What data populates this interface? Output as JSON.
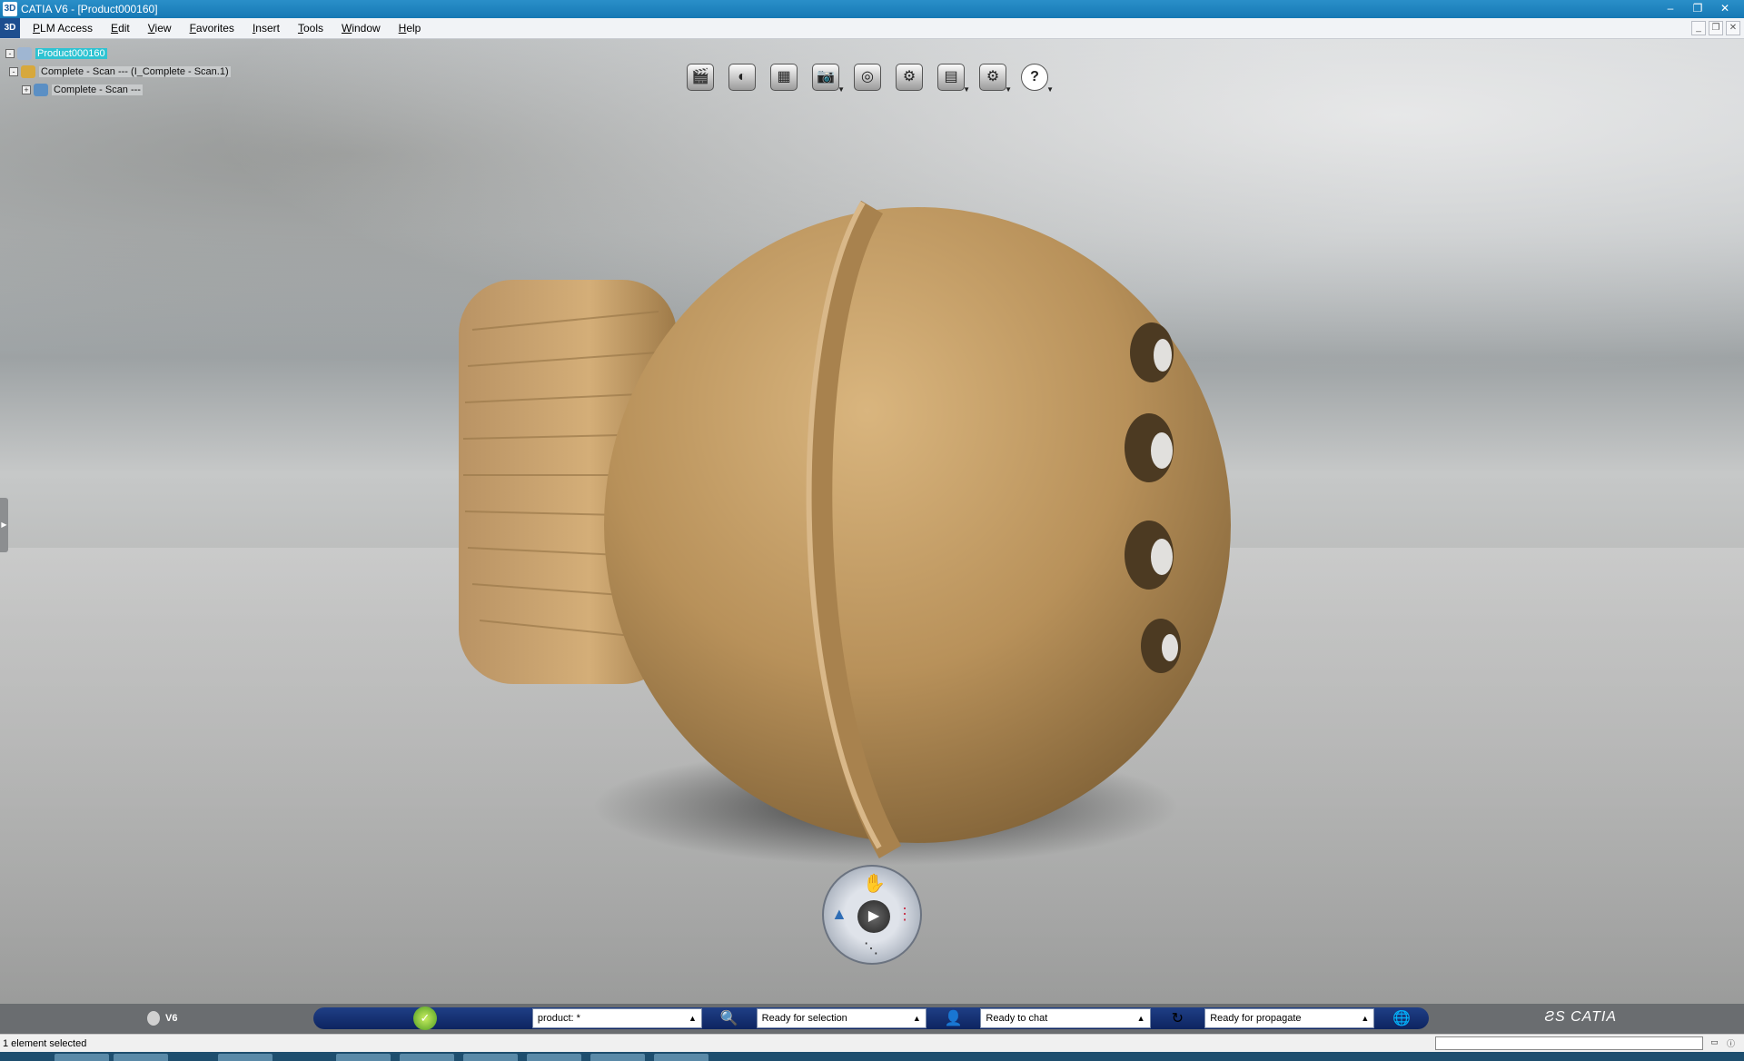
{
  "window": {
    "title": "CATIA V6 - [Product000160]",
    "controls": [
      "–",
      "❐",
      "✕"
    ]
  },
  "menu": {
    "items": [
      "PLM Access",
      "Edit",
      "View",
      "Favorites",
      "Insert",
      "Tools",
      "Window",
      "Help"
    ],
    "mdi_controls": [
      "_",
      "❐",
      "✕"
    ]
  },
  "tree": {
    "root": "Product000160",
    "child1": "Complete - Scan --- (I_Complete - Scan.1)",
    "child2": "Complete - Scan ---"
  },
  "toolbar": {
    "icons": [
      {
        "name": "clapperboard-icon",
        "glyph": "🎬",
        "caret": false
      },
      {
        "name": "material-sphere-icon",
        "glyph": "◐",
        "caret": false
      },
      {
        "name": "environment-icon",
        "glyph": "▦",
        "caret": false
      },
      {
        "name": "camera-icon",
        "glyph": "📷",
        "caret": true
      },
      {
        "name": "lens-icon",
        "glyph": "◎",
        "caret": false
      },
      {
        "name": "gear-icon",
        "glyph": "⚙",
        "caret": false
      },
      {
        "name": "database-icon",
        "glyph": "▤",
        "caret": true
      },
      {
        "name": "settings-tree-icon",
        "glyph": "⚙",
        "caret": true
      },
      {
        "name": "help-icon",
        "glyph": "?",
        "caret": true
      }
    ]
  },
  "compass": {
    "play": "▶",
    "top": "✋",
    "left": "▲",
    "right": "⋮",
    "bottom": "⋱"
  },
  "statusbar": {
    "brand_small": "V6",
    "fields": [
      {
        "value": "product: *",
        "icon": "🔍"
      },
      {
        "value": "Ready for selection",
        "icon": "👤"
      },
      {
        "value": "Ready to chat",
        "icon": "↻"
      },
      {
        "value": "Ready for propagate",
        "icon": "🌐"
      }
    ],
    "catia_logo": "ƧS CATIA"
  },
  "message": {
    "text": "1 element selected"
  }
}
